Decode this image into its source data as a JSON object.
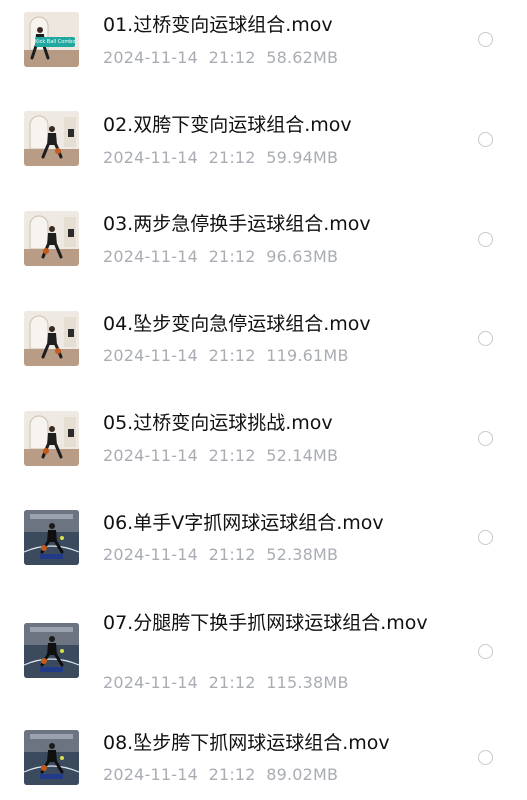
{
  "files": [
    {
      "name": "01.过桥变向运球组合.mov",
      "date": "2024-11-14",
      "time": "21:12",
      "size": "58.62MB",
      "thumb_kind": "room",
      "thumb_caption": "Kick Ball Combo"
    },
    {
      "name": "02.双胯下变向运球组合.mov",
      "date": "2024-11-14",
      "time": "21:12",
      "size": "59.94MB",
      "thumb_kind": "room"
    },
    {
      "name": "03.两步急停换手运球组合.mov",
      "date": "2024-11-14",
      "time": "21:12",
      "size": "96.63MB",
      "thumb_kind": "room"
    },
    {
      "name": "04.坠步变向急停运球组合.mov",
      "date": "2024-11-14",
      "time": "21:12",
      "size": "119.61MB",
      "thumb_kind": "room"
    },
    {
      "name": "05.过桥变向运球挑战.mov",
      "date": "2024-11-14",
      "time": "21:12",
      "size": "52.14MB",
      "thumb_kind": "room"
    },
    {
      "name": "06.单手V字抓网球运球组合.mov",
      "date": "2024-11-14",
      "time": "21:12",
      "size": "52.38MB",
      "thumb_kind": "court"
    },
    {
      "name": "07.分腿胯下换手抓网球运球组合.mov",
      "date": "2024-11-14",
      "time": "21:12",
      "size": "115.38MB",
      "thumb_kind": "court"
    },
    {
      "name": "08.坠步胯下抓网球运球组合.mov",
      "date": "2024-11-14",
      "time": "21:12",
      "size": "89.02MB",
      "thumb_kind": "court"
    }
  ]
}
